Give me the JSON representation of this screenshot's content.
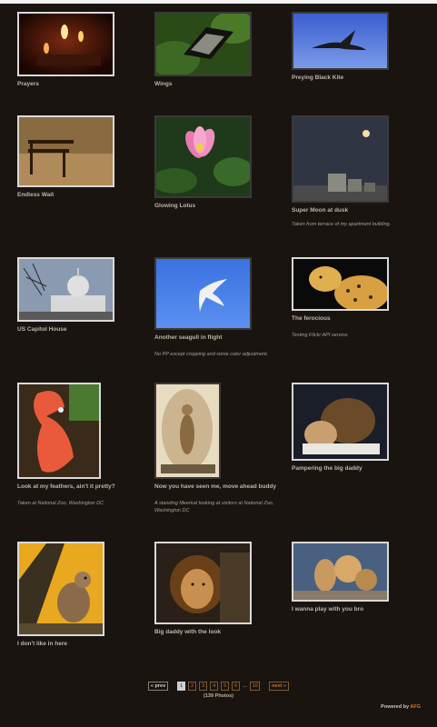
{
  "photos": [
    {
      "title": "Prayers",
      "desc": "",
      "icon": "candles-photo"
    },
    {
      "title": "Wings",
      "desc": "",
      "icon": "butterfly-photo"
    },
    {
      "title": "Preying Black Kite",
      "desc": "",
      "icon": "kite-photo"
    },
    {
      "title": "Endless Wait",
      "desc": "",
      "icon": "bench-photo"
    },
    {
      "title": "Glowing Lotus",
      "desc": "",
      "icon": "lotus-photo"
    },
    {
      "title": "Super Moon at dusk",
      "desc": "Taken from terrace of my apartment building.",
      "icon": "moon-photo"
    },
    {
      "title": "US Capitol House",
      "desc": "",
      "icon": "capitol-photo"
    },
    {
      "title": "Another seagull in flight",
      "desc": "No PP except cropping and some color adjustment.",
      "icon": "seagull-photo"
    },
    {
      "title": "The ferocious",
      "desc": "Testing Flickr API service.",
      "icon": "cheetah-photo"
    },
    {
      "title": "Look at my feathers, ain't it pretty?",
      "desc": "Taken at National Zoo, Washington DC",
      "icon": "flamingo-photo"
    },
    {
      "title": "Now you have seen me, move ahead buddy",
      "desc": "A standing Meerkat looking at visitors at National Zoo, Washington DC",
      "icon": "meerkat-photo"
    },
    {
      "title": "Pampering the big daddy",
      "desc": "",
      "icon": "lions-photo"
    },
    {
      "title": "I don't like in here",
      "desc": "",
      "icon": "meerkat-tree-photo"
    },
    {
      "title": "Big daddy with the look",
      "desc": "",
      "icon": "lion-photo"
    },
    {
      "title": "I wanna play with you bro",
      "desc": "",
      "icon": "lion-cubs-photo"
    }
  ],
  "pager": {
    "prev": "« prev",
    "pages": [
      "1",
      "2",
      "3",
      "4",
      "5",
      "6"
    ],
    "ellipsis": "...",
    "last": "10",
    "next": "next »",
    "current": "1",
    "count": "(139 Photos)"
  },
  "footer": {
    "powered": "Powered by",
    "brand": "AFG"
  }
}
